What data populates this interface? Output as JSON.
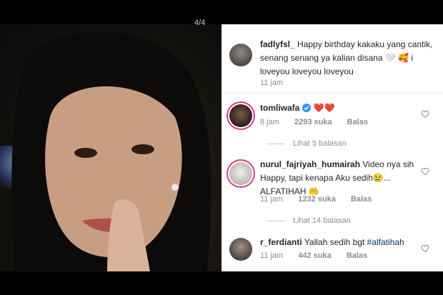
{
  "viewer": {
    "counter": "4/4"
  },
  "comments": [
    {
      "username": "fadlyfsl_",
      "text": "Happy birthday kakaku yang cantik, senang senang ya kalian disana 🤍 🥰 i loveyou loveyou loveyou",
      "time": "11 jam"
    },
    {
      "username": "tomliwafa",
      "verified": true,
      "text": "❤️❤️",
      "time": "8 jam",
      "likes": "2293 suka",
      "reply": "Balas",
      "view_replies": "Lihat 5 balasan"
    },
    {
      "username": "nurul_fajriyah_humairah",
      "text": "Video nya sih Happy, tapi kenapa Aku sedih😢... ALFATIHAH 🤲",
      "time": "11 jam",
      "likes": "1232 suka",
      "reply": "Balas",
      "view_replies": "Lihat 14 balasan"
    },
    {
      "username": "r_ferdianti",
      "text": "Yallah sedih bgt",
      "hashtag": "#alfatihah",
      "time": "11 jam",
      "likes": "442 suka",
      "reply": "Balas"
    }
  ],
  "colors": {
    "story_ring": "#d63c8c",
    "verified": "#3897f0",
    "hashtag": "#00376b"
  }
}
